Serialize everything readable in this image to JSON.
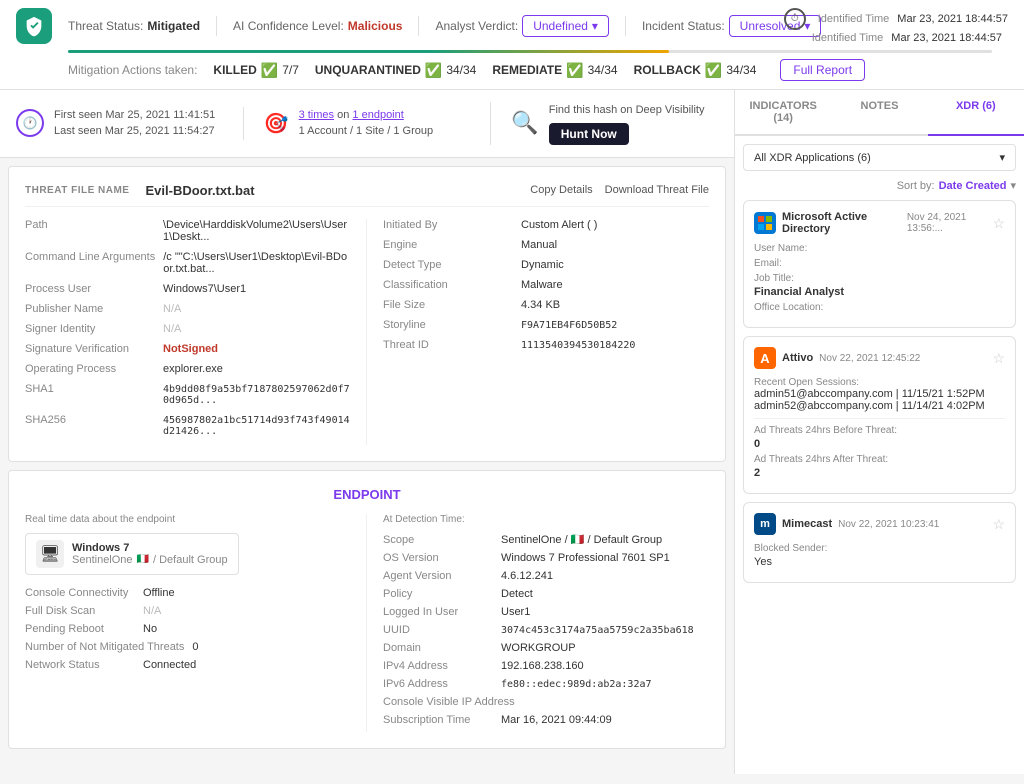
{
  "header": {
    "threat_status_label": "Threat Status:",
    "threat_status_value": "Mitigated",
    "ai_confidence_label": "AI Confidence Level:",
    "ai_confidence_value": "Malicious",
    "analyst_verdict_label": "Analyst Verdict:",
    "analyst_verdict_value": "Undefined",
    "incident_status_label": "Incident Status:",
    "incident_status_value": "Unresolved",
    "identified_time_label1": "Identified Time",
    "identified_time_val1": "Mar 23, 2021 18:44:57",
    "identified_time_label2": "Identified Time",
    "identified_time_val2": "Mar 23, 2021 18:44:57",
    "mitigation_label1": "KILLED",
    "mitigation_val1": "7/7",
    "mitigation_label2": "UNQUARANTINED",
    "mitigation_val2": "34/34",
    "mitigation_label3": "REMEDIATE",
    "mitigation_val3": "34/34",
    "mitigation_label4": "ROLLBACK",
    "mitigation_val4": "34/34",
    "mitigation_actions_label": "Mitigation Actions taken:",
    "full_report_label": "Full Report"
  },
  "info_bar": {
    "first_seen_label": "First seen",
    "first_seen_val": "Mar 25, 2021 11:41:51",
    "last_seen_label": "Last seen",
    "last_seen_val": "Mar 25, 2021 11:54:27",
    "times_label": "3 times",
    "on_label": "on",
    "endpoint_count": "1 endpoint",
    "account_info": "1 Account / 1 Site / 1 Group",
    "deep_visibility_label": "Find this hash on Deep Visibility",
    "hunt_now_label": "Hunt Now"
  },
  "threat_file": {
    "section_label": "THREAT FILE NAME",
    "filename": "Evil-BDoor.txt.bat",
    "copy_details_label": "Copy Details",
    "download_label": "Download Threat File",
    "fields": {
      "path_key": "Path",
      "path_val": "\\Device\\HarddiskVolume2\\Users\\User1\\Deskt...",
      "cmdline_key": "Command Line Arguments",
      "cmdline_val": "/c \"\"C:\\Users\\User1\\Desktop\\Evil-BDoor.txt.bat...",
      "process_user_key": "Process User",
      "process_user_val": "Windows7\\User1",
      "publisher_key": "Publisher Name",
      "publisher_val": "N/A",
      "signer_key": "Signer Identity",
      "signer_val": "N/A",
      "sig_verify_key": "Signature Verification",
      "sig_verify_val": "NotSigned",
      "op_process_key": "Operating Process",
      "op_process_val": "explorer.exe",
      "sha1_key": "SHA1",
      "sha1_val": "4b9dd08f9a53bf7187802597062d0f70d965d...",
      "sha256_key": "SHA256",
      "sha256_val": "456987802a1bc51714d93f743f49014d21426...",
      "initiated_by_key": "Initiated By",
      "initiated_by_val": "Custom Alert (            )",
      "engine_key": "Engine",
      "engine_val": "Manual",
      "detect_type_key": "Detect Type",
      "detect_type_val": "Dynamic",
      "classification_key": "Classification",
      "classification_val": "Malware",
      "file_size_key": "File Size",
      "file_size_val": "4.34 KB",
      "storyline_key": "Storyline",
      "storyline_val": "F9A71EB4F6D50B52",
      "threat_id_key": "Threat ID",
      "threat_id_val": "1113540394530184220"
    }
  },
  "endpoint": {
    "section_title": "ENDPOINT",
    "realtime_label": "Real time data about the endpoint",
    "os_name": "Windows 7",
    "os_sub": "SentinelOne",
    "os_group": "/ Default Group",
    "console_connectivity_key": "Console Connectivity",
    "console_connectivity_val": "Offline",
    "full_disk_scan_key": "Full Disk Scan",
    "full_disk_scan_val": "N/A",
    "pending_reboot_key": "Pending Reboot",
    "pending_reboot_val": "No",
    "not_mitigated_key": "Number of Not Mitigated Threats",
    "not_mitigated_val": "0",
    "network_status_key": "Network Status",
    "network_status_val": "Connected",
    "at_detection_label": "At Detection Time:",
    "scope_key": "Scope",
    "scope_val": "SentinelOne / 🇮🇹  / Default Group",
    "os_version_key": "OS Version",
    "os_version_val": "Windows 7 Professional 7601 SP1",
    "agent_version_key": "Agent Version",
    "agent_version_val": "4.6.12.241",
    "policy_key": "Policy",
    "policy_val": "Detect",
    "logged_in_user_key": "Logged In User",
    "logged_in_user_val": "User1",
    "uuid_key": "UUID",
    "uuid_val": "3074c453c3174a75aa5759c2a35ba618",
    "domain_key": "Domain",
    "domain_val": "WORKGROUP",
    "ipv4_key": "IPv4 Address",
    "ipv4_val": "192.168.238.160",
    "ipv6_key": "IPv6 Address",
    "ipv6_val": "fe80::edec:989d:ab2a:32a7",
    "console_visible_ip_key": "Console Visible IP Address",
    "console_visible_ip_val": "",
    "subscription_time_key": "Subscription Time",
    "subscription_time_val": "Mar 16, 2021 09:44:09"
  },
  "right_panel": {
    "tabs": [
      {
        "label": "INDICATORS (14)",
        "id": "indicators"
      },
      {
        "label": "NOTES",
        "id": "notes"
      },
      {
        "label": "XDR (6)",
        "id": "xdr",
        "active": true
      }
    ],
    "filter_label": "All XDR Applications (6)",
    "sort_label": "Sort by:",
    "sort_value": "Date Created",
    "cards": [
      {
        "app_name": "Microsoft Active Directory",
        "app_time": "Nov 24, 2021 13:56:...",
        "app_icon_type": "ms",
        "app_icon_text": "AD",
        "fields": [
          {
            "key": "User Name:",
            "value": ""
          },
          {
            "key": "Email:",
            "value": ""
          },
          {
            "key": "Job Title:",
            "value": "Financial Analyst"
          },
          {
            "key": "Office Location:",
            "value": ""
          }
        ]
      },
      {
        "app_name": "Attivo",
        "app_time": "Nov 22, 2021 12:45:22",
        "app_icon_type": "attivo",
        "app_icon_text": "A",
        "fields": [
          {
            "key": "Recent Open Sessions:",
            "value": "admin51@abccompany.com | 11/15/21 1:52PM\nadmin52@abccompany.com | 11/14/21 4:02PM"
          },
          {
            "key": "Ad Threats 24hrs Before Threat:",
            "value": "0"
          },
          {
            "key": "Ad Threats 24hrs After Threat:",
            "value": "2"
          }
        ]
      },
      {
        "app_name": "Mimecast",
        "app_time": "Nov 22, 2021 10:23:41",
        "app_icon_type": "mimecast",
        "app_icon_text": "m",
        "fields": [
          {
            "key": "Blocked Sender:",
            "value": "Yes"
          }
        ]
      }
    ]
  }
}
